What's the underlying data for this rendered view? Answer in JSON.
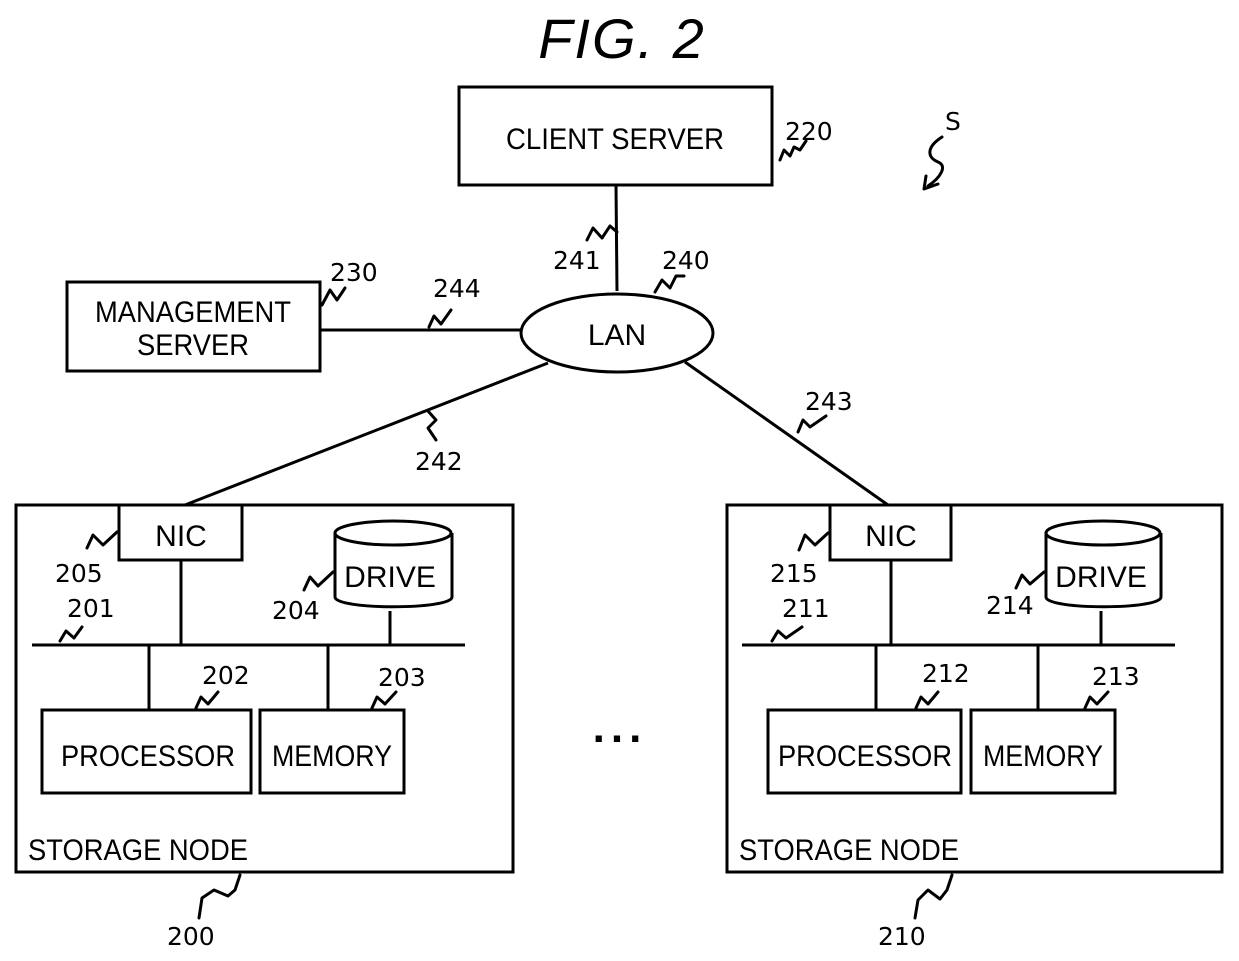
{
  "figure": {
    "title": "FIG. 2",
    "system_ref": "S"
  },
  "client_server": {
    "label": "CLIENT SERVER",
    "ref": "220"
  },
  "management_server": {
    "label_line1": "MANAGEMENT",
    "label_line2": "SERVER",
    "ref": "230"
  },
  "lan": {
    "label": "LAN",
    "ref": "240"
  },
  "links": {
    "client_lan": "241",
    "lan_node_200": "242",
    "lan_node_210": "243",
    "mgmt_lan": "244"
  },
  "nodes": [
    {
      "label": "STORAGE NODE",
      "ref": "200",
      "bus_ref": "201",
      "processor": {
        "label": "PROCESSOR",
        "ref": "202"
      },
      "memory": {
        "label": "MEMORY",
        "ref": "203"
      },
      "drive": {
        "label": "DRIVE",
        "ref": "204"
      },
      "nic": {
        "label": "NIC",
        "ref": "205"
      }
    },
    {
      "label": "STORAGE NODE",
      "ref": "210",
      "bus_ref": "211",
      "processor": {
        "label": "PROCESSOR",
        "ref": "212"
      },
      "memory": {
        "label": "MEMORY",
        "ref": "213"
      },
      "drive": {
        "label": "DRIVE",
        "ref": "214"
      },
      "nic": {
        "label": "NIC",
        "ref": "215"
      }
    }
  ],
  "ellipsis": "..."
}
